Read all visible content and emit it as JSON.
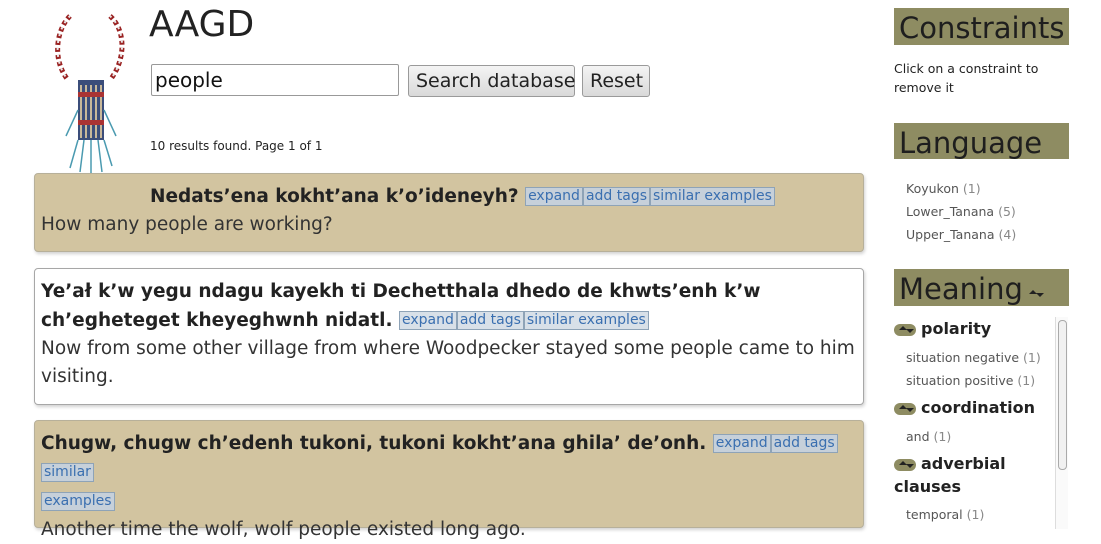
{
  "header": {
    "title": "AAGD",
    "logo": "beaded-necklace-logo"
  },
  "search": {
    "value": "people",
    "search_button": "Search database",
    "reset_button": "Reset"
  },
  "results_count": "10 results found. Page 1 of 1",
  "results": [
    {
      "example": "Nedats’ena kokht’ana k’o’ideneyh?",
      "translation": "How many people are working?",
      "expand": "expand",
      "add_tags": "add tags",
      "similar": "similar examples"
    },
    {
      "example": "Ye’ał k’w yegu ndagu kayekh ti Dechetthala dhedo de khwts’enh k’w ch’egheteget kheyeghwnh nidatl.",
      "translation": "Now from some other village from where Woodpecker stayed some people came to him visiting.",
      "expand": "expand",
      "add_tags": "add tags",
      "similar": "similar examples"
    },
    {
      "example": "Chugw, chugw ch’edenh tukoni, tukoni kokht’ana ghila’ de’onh.",
      "translation": "Another time the wolf, wolf people existed long ago.",
      "expand": "expand",
      "add_tags": "add tags",
      "similar_a": "similar",
      "similar_b": "examples"
    }
  ],
  "sidebar": {
    "constraints": {
      "title": "Constraints",
      "hint": "Click on a constraint to remove it"
    },
    "language": {
      "title": "Language",
      "items": [
        {
          "label": "Koyukon",
          "count": "(1)"
        },
        {
          "label": "Lower_Tanana",
          "count": "(5)"
        },
        {
          "label": "Upper_Tanana",
          "count": "(4)"
        }
      ]
    },
    "meaning": {
      "title": "Meaning",
      "categories": [
        {
          "label": "polarity",
          "items": [
            {
              "label": "situation negative",
              "count": "(1)"
            },
            {
              "label": "situation positive",
              "count": "(1)"
            }
          ]
        },
        {
          "label": "coordination",
          "items": [
            {
              "label": "and",
              "count": "(1)"
            }
          ]
        },
        {
          "label": "adverbial clauses",
          "items": [
            {
              "label": "temporal",
              "count": "(1)"
            }
          ]
        }
      ]
    }
  },
  "colors": {
    "card_tan": "#d2c4a0",
    "sidebar_header": "#8e8c62",
    "link_blue": "#3a6fb0"
  }
}
